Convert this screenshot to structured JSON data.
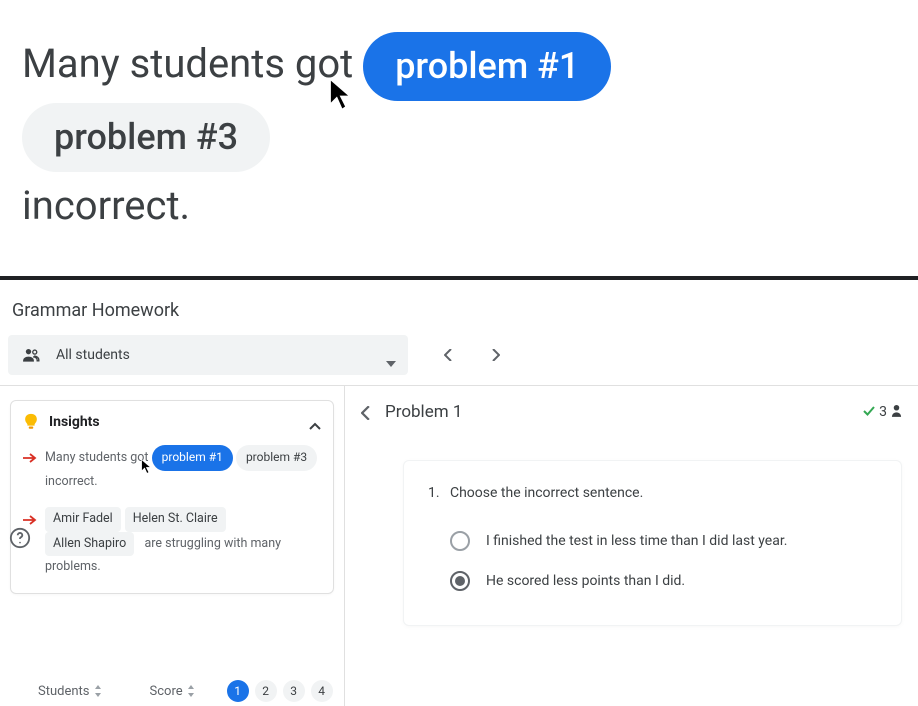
{
  "hero": {
    "text_before": "Many students got ",
    "pill_active": "problem #1",
    "pill_inactive": "problem #3",
    "text_after": "incorrect."
  },
  "app": {
    "title": "Grammar Homework",
    "students_dropdown": "All students"
  },
  "insights": {
    "heading": "Insights",
    "row1": {
      "prefix": "Many students got",
      "chip_active": "problem #1",
      "chip_inactive": "problem #3",
      "suffix": "incorrect."
    },
    "row2": {
      "students": [
        "Amir Fadel",
        "Helen St. Claire",
        "Allen Shapiro"
      ],
      "suffix": "are struggling with many problems."
    }
  },
  "list": {
    "col_students": "Students",
    "col_score": "Score",
    "pages": [
      "1",
      "2",
      "3",
      "4"
    ],
    "active_page": 0
  },
  "problem": {
    "title": "Problem 1",
    "correct_count": "3",
    "question_number": "1.",
    "question_text": "Choose the incorrect sentence.",
    "options": [
      {
        "label": "I finished the test in less time than I did last year.",
        "selected": false
      },
      {
        "label": "He scored less points than I did.",
        "selected": true
      }
    ]
  }
}
